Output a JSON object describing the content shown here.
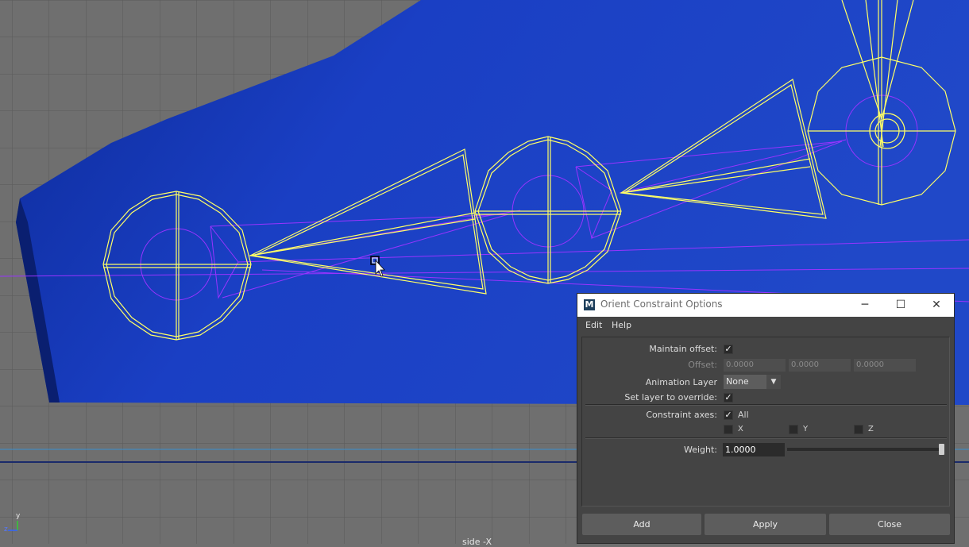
{
  "viewport": {
    "camera_label": "side -X",
    "axis_y": "y",
    "axis_z": "z",
    "colors": {
      "grid_bg": "#6f6f6f",
      "grid_line": "#5a5a5a",
      "mesh": "#1f3fbf",
      "joint": "#ffff66",
      "constraint": "#9933ff"
    }
  },
  "dialog": {
    "title": "Orient Constraint Options",
    "icon_label": "M",
    "window_buttons": {
      "minimize": "─",
      "maximize": "☐",
      "close": "✕"
    },
    "menu": [
      "Edit",
      "Help"
    ],
    "maintain_offset": {
      "label": "Maintain offset:",
      "checked": "✓"
    },
    "offset": {
      "label": "Offset:",
      "values": [
        "0.0000",
        "0.0000",
        "0.0000"
      ]
    },
    "animation_layer": {
      "label": "Animation Layer",
      "value": "None",
      "arrow": "▼"
    },
    "set_layer_override": {
      "label": "Set layer to override:",
      "checked": "✓"
    },
    "constraint_axes": {
      "label": "Constraint axes:",
      "all": {
        "label": "All",
        "checked": "✓"
      },
      "x": {
        "label": "X",
        "checked": ""
      },
      "y": {
        "label": "Y",
        "checked": ""
      },
      "z": {
        "label": "Z",
        "checked": ""
      }
    },
    "weight": {
      "label": "Weight:",
      "value": "1.0000",
      "slider_fraction": 1.0
    },
    "buttons": {
      "add": "Add",
      "apply": "Apply",
      "close": "Close"
    }
  }
}
